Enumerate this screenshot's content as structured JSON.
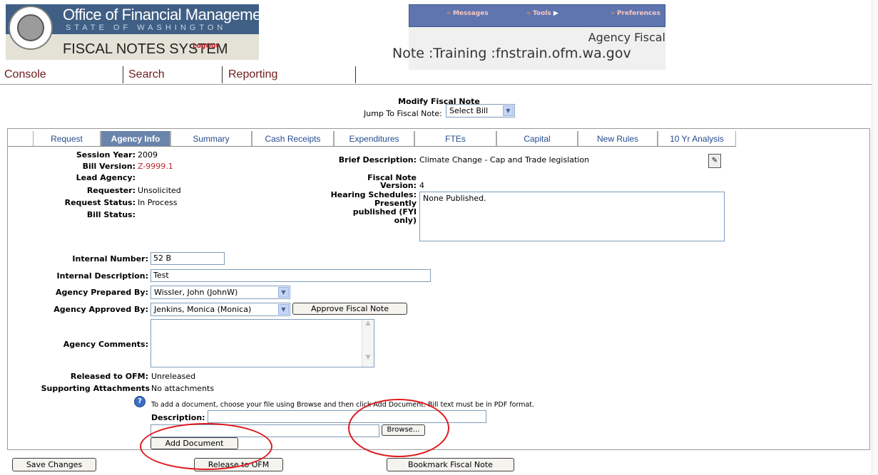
{
  "header": {
    "org_title": "Office of Financial Management",
    "org_subtitle": "STATE OF WASHINGTON",
    "system_name": "FISCAL NOTES SYSTEM",
    "logout": "LogOut",
    "nav": [
      {
        "label": "Messages"
      },
      {
        "label": "Tools"
      },
      {
        "label": "Preferences"
      }
    ],
    "window_title_1": "Agency Fiscal",
    "window_title_2": "Note :Training :fnstrain.ofm.wa.gov"
  },
  "menu": {
    "console": "Console",
    "search": "Search",
    "reporting": "Reporting"
  },
  "page": {
    "title": "Modify Fiscal Note",
    "jump_label": "Jump To Fiscal Note:",
    "jump_value": "Select Bill"
  },
  "tabs": [
    {
      "label": "Request"
    },
    {
      "label": "Agency Info"
    },
    {
      "label": "Summary"
    },
    {
      "label": "Cash Receipts"
    },
    {
      "label": "Expenditures"
    },
    {
      "label": "FTEs"
    },
    {
      "label": "Capital"
    },
    {
      "label": "New Rules"
    },
    {
      "label": "10 Yr Analysis"
    }
  ],
  "info": {
    "session_year_label": "Session Year:",
    "session_year": "2009",
    "bill_version_label": "Bill Version:",
    "bill_version": "Z-9999.1",
    "lead_agency_label": "Lead Agency:",
    "requester_label": "Requester:",
    "requester": "Unsolicited",
    "request_status_label": "Request Status:",
    "request_status": "In Process",
    "bill_status_label": "Bill Status:",
    "brief_desc_label": "Brief Description:",
    "brief_desc": "Climate Change - Cap and Trade legislation",
    "fn_version_label_1": "Fiscal Note",
    "fn_version_label_2": "Version:",
    "fn_version": "4",
    "hearing_label_1": "Hearing Schedules:",
    "hearing_label_2": "Presently",
    "hearing_label_3": "published (FYI",
    "hearing_label_4": "only)",
    "hearing_value": "None Published."
  },
  "form": {
    "internal_number_label": "Internal Number:",
    "internal_number": "52 B",
    "internal_desc_label": "Internal Description:",
    "internal_desc": "Test",
    "prepared_by_label": "Agency Prepared By:",
    "prepared_by": "Wissler, John (JohnW)",
    "approved_by_label": "Agency Approved By:",
    "approved_by": "Jenkins, Monica (Monica)",
    "approve_button": "Approve Fiscal Note",
    "comments_label": "Agency Comments:",
    "released_label": "Released to OFM:",
    "released_value": "Unreleased",
    "attachments_label": "Supporting Attachments",
    "attachments_value": "No attachments",
    "attach_help": "To add a document, choose your file using Browse and then click Add Document. Bill text must be in PDF format.",
    "description_label": "Description:",
    "browse_button": "Browse...",
    "add_document_button": "Add Document"
  },
  "footer": {
    "save": "Save Changes",
    "release": "Release to OFM",
    "bookmark": "Bookmark Fiscal Note"
  },
  "colors": {
    "header_blue": "#3f5f85",
    "nav_blue": "#5e75b0",
    "active_tab": "#6b84ab",
    "annotation_red": "#e0191e"
  }
}
